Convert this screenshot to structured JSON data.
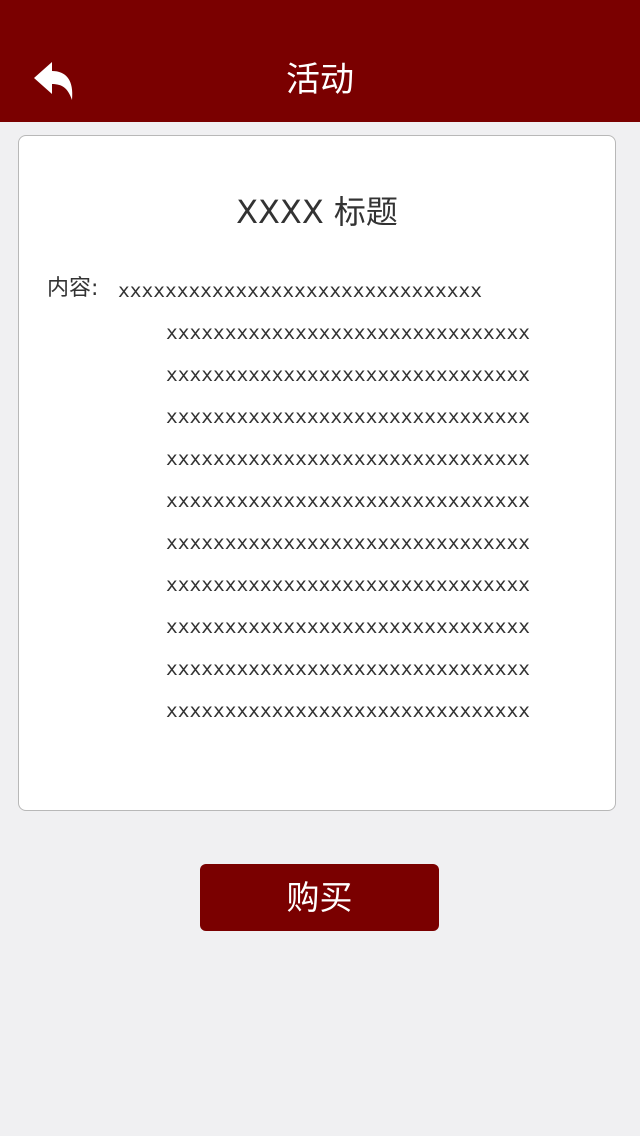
{
  "header": {
    "title": "活动",
    "back_icon": "back-arrow-icon",
    "background_color": "#7a0000"
  },
  "card": {
    "title": "XXXX 标题",
    "content_label": "内容:",
    "content_first_line": "xxxxxxxxxxxxxxxxxxxxxxxxxxxxxxx",
    "content_lines": [
      "xxxxxxxxxxxxxxxxxxxxxxxxxxxxxxx",
      "xxxxxxxxxxxxxxxxxxxxxxxxxxxxxxx",
      "xxxxxxxxxxxxxxxxxxxxxxxxxxxxxxx",
      "xxxxxxxxxxxxxxxxxxxxxxxxxxxxxxx",
      "xxxxxxxxxxxxxxxxxxxxxxxxxxxxxxx",
      "xxxxxxxxxxxxxxxxxxxxxxxxxxxxxxx",
      "xxxxxxxxxxxxxxxxxxxxxxxxxxxxxxx",
      "xxxxxxxxxxxxxxxxxxxxxxxxxxxxxxx",
      "xxxxxxxxxxxxxxxxxxxxxxxxxxxxxxx",
      "xxxxxxxxxxxxxxxxxxxxxxxxxxxxxxx"
    ]
  },
  "buy_button": {
    "label": "购买",
    "color": "#7a0000"
  }
}
